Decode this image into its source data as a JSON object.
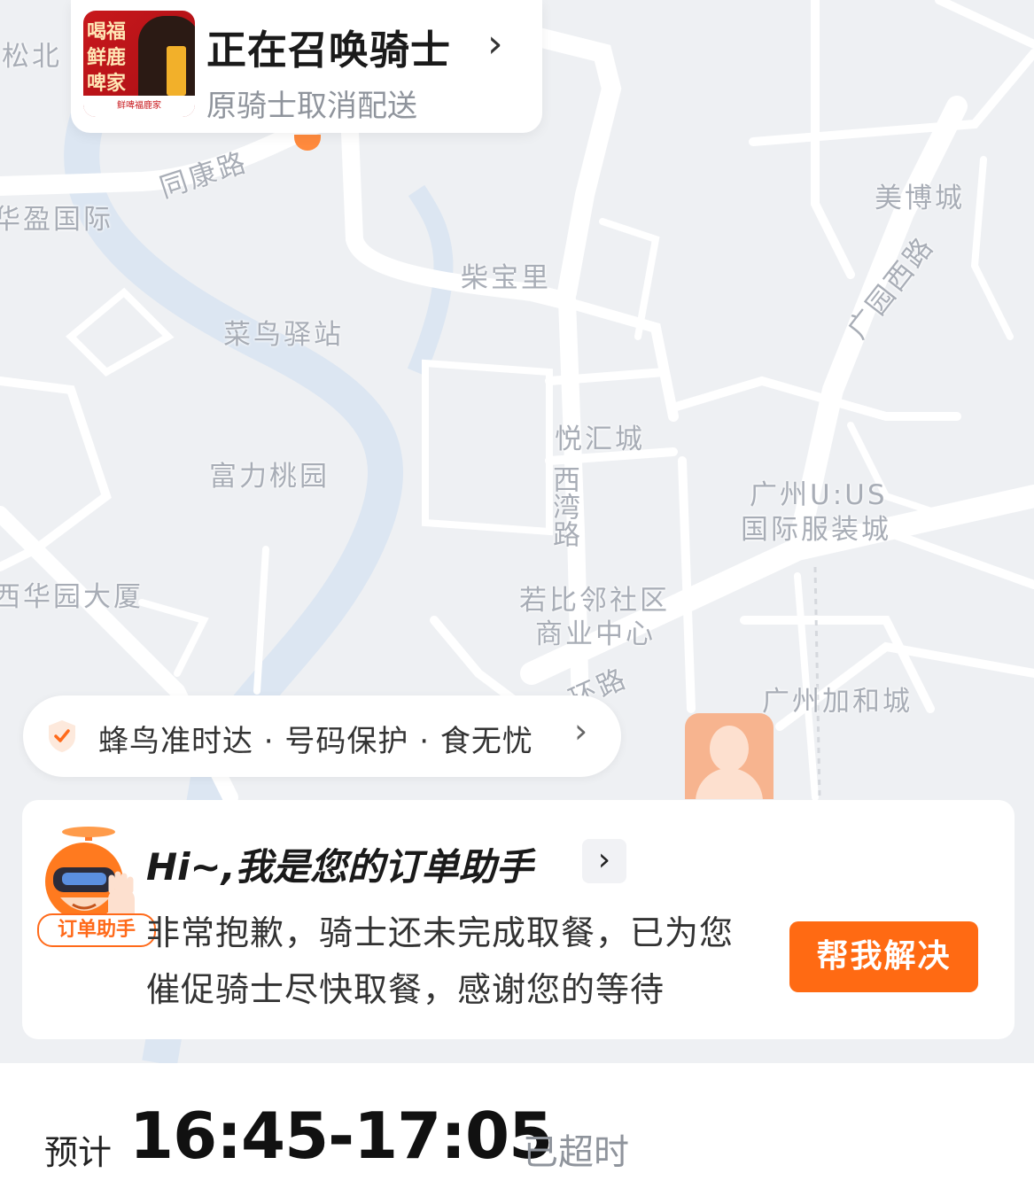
{
  "map": {
    "labels": [
      {
        "id": "songbei",
        "text": "松北"
      },
      {
        "id": "tongkang",
        "text": "同康路"
      },
      {
        "id": "huaying",
        "text": "华盈国际"
      },
      {
        "id": "chaibao",
        "text": "柴宝里"
      },
      {
        "id": "cainiao",
        "text": "菜鸟驿站"
      },
      {
        "id": "meibo",
        "text": "美博城"
      },
      {
        "id": "guangyuan",
        "text": "广园西路"
      },
      {
        "id": "yuehui",
        "text": "悦汇城"
      },
      {
        "id": "fuli",
        "text": "富力桃园"
      },
      {
        "id": "xiwan",
        "text": "西湾路"
      },
      {
        "id": "guangzhouus1",
        "text": "广州U:US"
      },
      {
        "id": "guangzhouus2",
        "text": "国际服装城"
      },
      {
        "id": "xihuayuan",
        "text": "西华园大厦"
      },
      {
        "id": "ruobi1",
        "text": "若比邻社区"
      },
      {
        "id": "ruobi2",
        "text": "商业中心"
      },
      {
        "id": "huanlu",
        "text": "环路"
      },
      {
        "id": "jiahe",
        "text": "广州加和城"
      }
    ]
  },
  "status_card": {
    "logo_text": "喝福鲜鹿啤家",
    "logo_band": "鲜啤福鹿家",
    "title": "正在召唤骑士",
    "subtitle": "原骑士取消配送",
    "chevron": "›"
  },
  "guarantee": {
    "text": "蜂鸟准时达 · 号码保护 · 食无忧",
    "chevron": "›",
    "accent_color": "#ff6a1a"
  },
  "assistant": {
    "badge": "订单助手",
    "title": "Hi~,我是您的订单助手",
    "chevron": "›",
    "message": "非常抱歉，骑士还未完成取餐，已为您催促骑士尽快取餐，感谢您的等待",
    "button_label": "帮我解决",
    "button_color": "#ff6a13"
  },
  "eta": {
    "label": "预计",
    "time": "16:45-17:05",
    "status": "已超时"
  }
}
